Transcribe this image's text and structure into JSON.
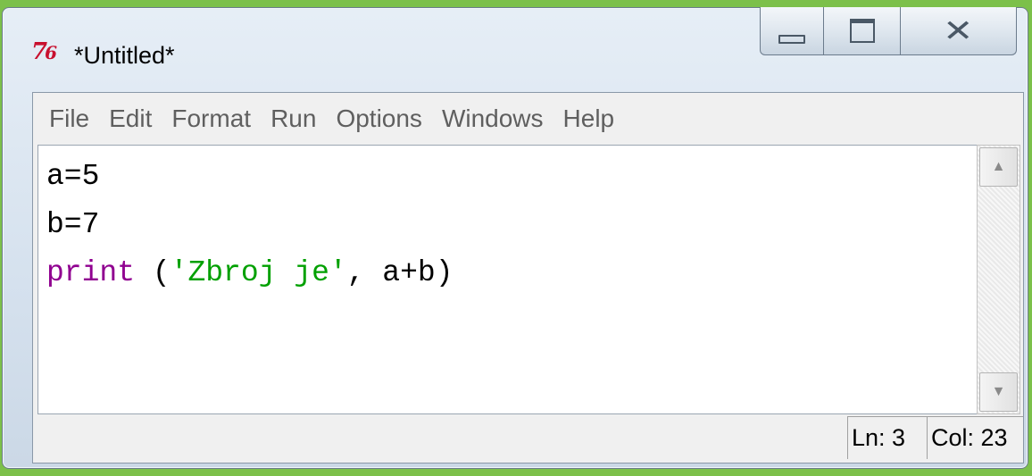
{
  "window": {
    "title": "*Untitled*",
    "icon": "idle-python-icon",
    "icon_glyph": "7⁄6"
  },
  "caption_buttons": {
    "minimize": "minimize-icon",
    "maximize": "maximize-icon",
    "close": "close-icon"
  },
  "menu": {
    "items": [
      "File",
      "Edit",
      "Format",
      "Run",
      "Options",
      "Windows",
      "Help"
    ]
  },
  "editor": {
    "lines": [
      [
        {
          "text": "a=5",
          "type": "plain"
        }
      ],
      [
        {
          "text": "b=7",
          "type": "plain"
        }
      ],
      [
        {
          "text": "print",
          "type": "kw"
        },
        {
          "text": " (",
          "type": "plain"
        },
        {
          "text": "'Zbroj je'",
          "type": "str"
        },
        {
          "text": ", a+b)",
          "type": "plain"
        }
      ]
    ]
  },
  "status": {
    "ln": "Ln: 3",
    "col": "Col: 23"
  },
  "colors": {
    "keyword": "#900090",
    "string": "#00a000",
    "background": "#7cc04a"
  }
}
